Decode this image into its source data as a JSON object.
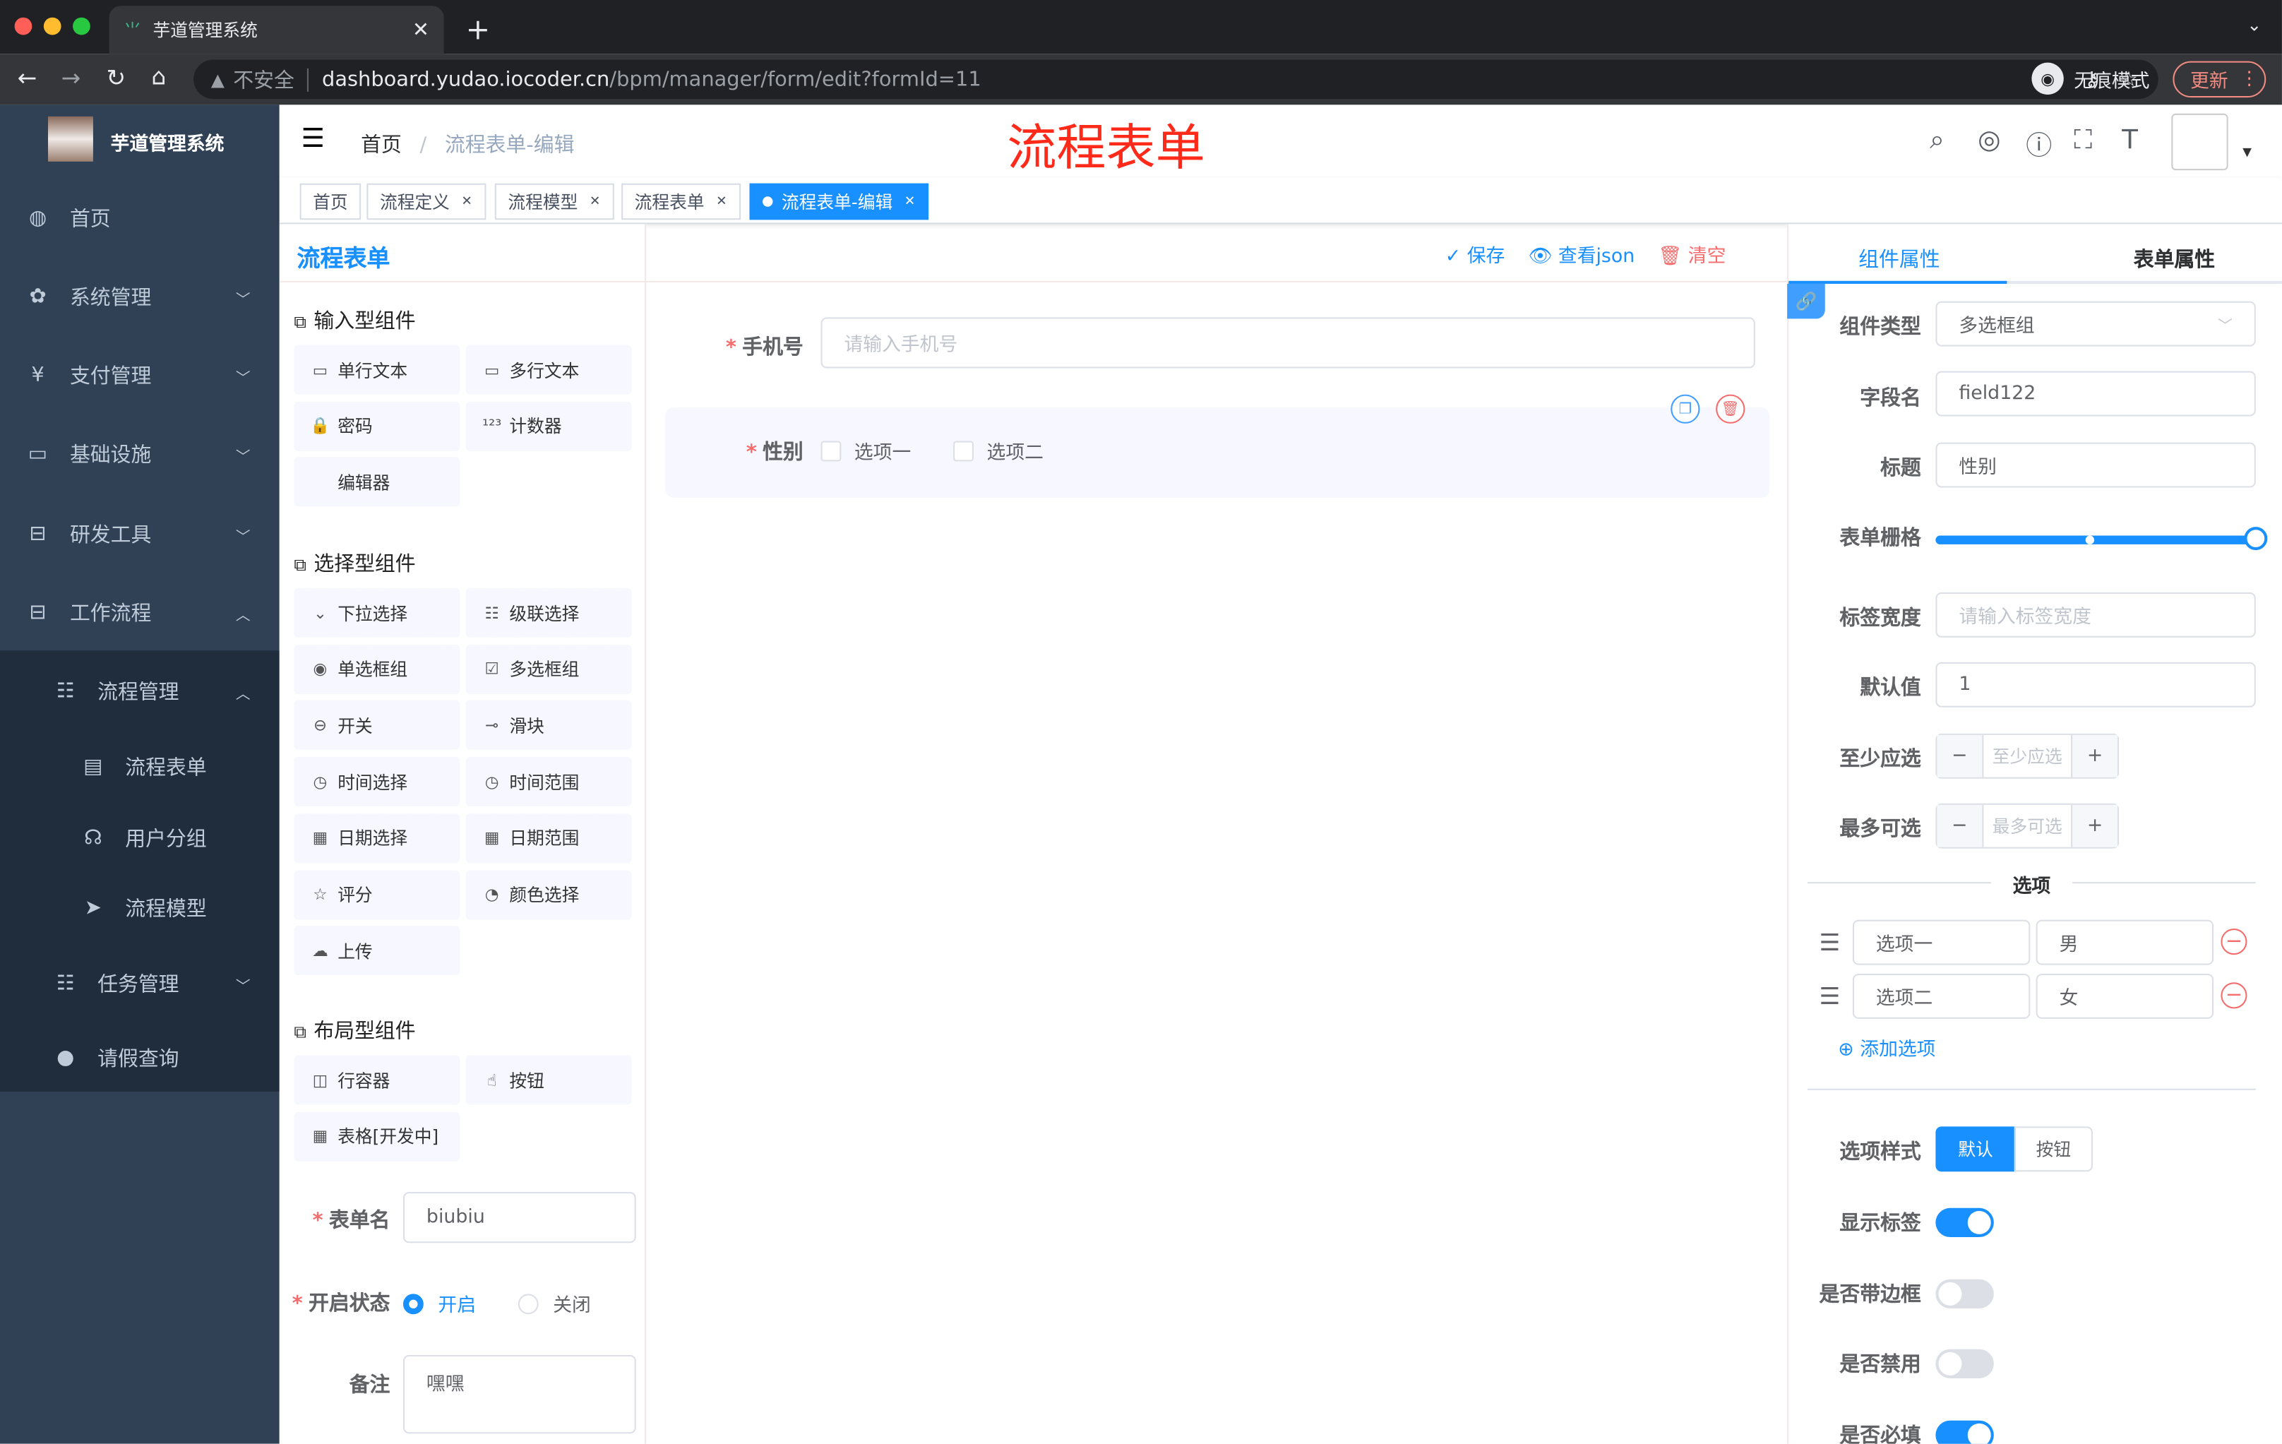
{
  "browser": {
    "tab_title": "芋道管理系统",
    "security": "不安全",
    "url_host": "dashboard.yudao.iocoder.cn",
    "url_path": "/bpm/manager/form/edit?formId=11",
    "incognito": "无痕模式",
    "update": "更新"
  },
  "sidebar": {
    "logo_title": "芋道管理系统",
    "items": [
      {
        "label": "首页",
        "icon": "dashboard-icon"
      },
      {
        "label": "系统管理",
        "icon": "gear-icon"
      },
      {
        "label": "支付管理",
        "icon": "yen-icon"
      },
      {
        "label": "基础设施",
        "icon": "monitor-icon"
      },
      {
        "label": "研发工具",
        "icon": "toolbox-icon"
      },
      {
        "label": "工作流程",
        "icon": "workflow-icon"
      },
      {
        "label": "流程管理",
        "icon": "tree-icon"
      },
      {
        "label": "流程表单",
        "icon": "form-icon"
      },
      {
        "label": "用户分组",
        "icon": "group-icon"
      },
      {
        "label": "流程模型",
        "icon": "send-icon"
      },
      {
        "label": "任务管理",
        "icon": "task-icon"
      },
      {
        "label": "请假查询",
        "icon": "user-icon"
      }
    ]
  },
  "navbar": {
    "breadcrumb_home": "首页",
    "breadcrumb_current": "流程表单-编辑",
    "annotation": "流程表单"
  },
  "tags": [
    "首页",
    "流程定义",
    "流程模型",
    "流程表单",
    "流程表单-编辑"
  ],
  "colors": {
    "primary": "#1890ff",
    "sidebar": "#304156",
    "danger": "#f56c6c",
    "annotation": "#ff2a1a"
  },
  "left": {
    "title": "流程表单",
    "groups": [
      {
        "title": "输入型组件",
        "items": [
          "单行文本",
          "多行文本",
          "密码",
          "计数器",
          "编辑器"
        ]
      },
      {
        "title": "选择型组件",
        "items": [
          "下拉选择",
          "级联选择",
          "单选框组",
          "多选框组",
          "开关",
          "滑块",
          "时间选择",
          "时间范围",
          "日期选择",
          "日期范围",
          "评分",
          "颜色选择",
          "上传"
        ]
      },
      {
        "title": "布局型组件",
        "items": [
          "行容器",
          "按钮",
          "表格[开发中]"
        ]
      }
    ],
    "form_name_label": "表单名",
    "form_name": "biubiu",
    "status_label": "开启状态",
    "status_on": "开启",
    "status_off": "关闭",
    "remark_label": "备注",
    "remark": "嘿嘿"
  },
  "toolbar": {
    "save": "保存",
    "view_json": "查看json",
    "clear": "清空"
  },
  "canvas": {
    "phone_label": "手机号",
    "phone_placeholder": "请输入手机号",
    "gender_label": "性别",
    "options": [
      "选项一",
      "选项二"
    ]
  },
  "right": {
    "tabs": [
      "组件属性",
      "表单属性"
    ],
    "type_label": "组件类型",
    "type_value": "多选框组",
    "field_label": "字段名",
    "field_value": "field122",
    "title_label": "标题",
    "title_value": "性别",
    "grid_label": "表单栅格",
    "grid_value": 24,
    "label_width_label": "标签宽度",
    "label_width_placeholder": "请输入标签宽度",
    "default_label": "默认值",
    "default_value": "1",
    "min_label": "至少应选",
    "min_placeholder": "至少应选",
    "max_label": "最多可选",
    "max_placeholder": "最多可选",
    "options_title": "选项",
    "options": [
      {
        "label": "选项一",
        "value": "男"
      },
      {
        "label": "选项二",
        "value": "女"
      }
    ],
    "add_option": "添加选项",
    "style_label": "选项样式",
    "style_default": "默认",
    "style_button": "按钮",
    "show_label": "显示标签",
    "show_label_on": true,
    "border_label": "是否带边框",
    "border_on": false,
    "disabled_label": "是否禁用",
    "disabled_on": false,
    "required_label": "是否必填",
    "required_on": true
  }
}
